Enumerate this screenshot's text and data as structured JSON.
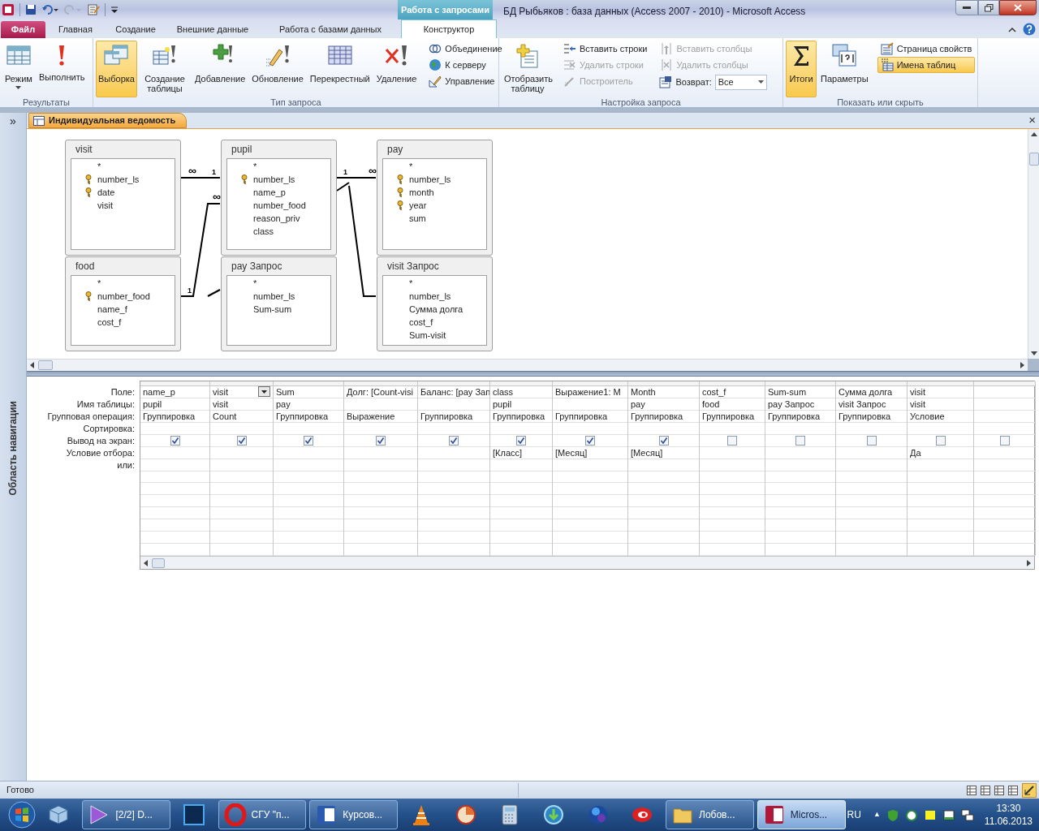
{
  "window": {
    "title": "БД Рыбьяков : база данных (Access 2007 - 2010)  -  Microsoft Access",
    "context_tab": "Работа с запросами"
  },
  "tabs": [
    {
      "label": "Файл",
      "kind": "file",
      "selected": false
    },
    {
      "label": "Главная",
      "kind": "tab",
      "selected": false
    },
    {
      "label": "Создание",
      "kind": "tab",
      "selected": false
    },
    {
      "label": "Внешние данные",
      "kind": "tab",
      "selected": false
    },
    {
      "label": "Работа с базами данных",
      "kind": "tab",
      "selected": false
    },
    {
      "label": "Конструктор",
      "kind": "tab",
      "selected": true
    }
  ],
  "ribbon": {
    "groups": [
      {
        "label": "Результаты",
        "items": [
          {
            "kind": "split",
            "label": "Режим",
            "selected": false,
            "disabled": false
          },
          {
            "kind": "large",
            "label": "Выполнить",
            "selected": false,
            "disabled": false
          }
        ]
      },
      {
        "label": "Тип запроса",
        "items": [
          {
            "kind": "large",
            "label": "Выборка",
            "selected": true,
            "disabled": false
          },
          {
            "kind": "large",
            "label": "Создание таблицы",
            "selected": false,
            "disabled": false
          },
          {
            "kind": "large",
            "label": "Добавление",
            "selected": false,
            "disabled": false
          },
          {
            "kind": "large",
            "label": "Обновление",
            "selected": false,
            "disabled": false
          },
          {
            "kind": "large",
            "label": "Перекрестный",
            "selected": false,
            "disabled": false
          },
          {
            "kind": "large",
            "label": "Удаление",
            "selected": false,
            "disabled": false
          },
          {
            "kind": "small",
            "label": "Объединение",
            "selected": false,
            "disabled": false
          },
          {
            "kind": "small",
            "label": "К серверу",
            "selected": false,
            "disabled": false
          },
          {
            "kind": "small",
            "label": "Управление",
            "selected": false,
            "disabled": false
          }
        ]
      },
      {
        "label": "Настройка запроса",
        "items": [
          {
            "kind": "large",
            "label": "Отобразить таблицу",
            "selected": false,
            "disabled": false
          },
          {
            "kind": "small",
            "label": "Вставить строки",
            "selected": false,
            "disabled": false
          },
          {
            "kind": "small",
            "label": "Удалить строки",
            "selected": false,
            "disabled": true
          },
          {
            "kind": "small",
            "label": "Построитель",
            "selected": false,
            "disabled": true
          },
          {
            "kind": "small",
            "label": "Вставить столбцы",
            "selected": false,
            "disabled": true
          },
          {
            "kind": "small",
            "label": "Удалить столбцы",
            "selected": false,
            "disabled": true
          },
          {
            "kind": "select",
            "label": "Возврат:",
            "value": "Все"
          }
        ]
      },
      {
        "label": "Показать или скрыть",
        "items": [
          {
            "kind": "large",
            "label": "Итоги",
            "selected": true,
            "disabled": false
          },
          {
            "kind": "large",
            "label": "Параметры",
            "selected": false,
            "disabled": false
          },
          {
            "kind": "small",
            "label": "Страница свойств",
            "selected": false,
            "disabled": false
          },
          {
            "kind": "small",
            "label": "Имена таблиц",
            "selected": true,
            "disabled": false
          }
        ]
      }
    ]
  },
  "nav_pane": {
    "toggle": "»",
    "title": "Область навигации"
  },
  "document_tab": {
    "title": "Индивидуальная ведомость",
    "close": "×"
  },
  "diagram": {
    "tables": [
      {
        "name": "visit",
        "fields": [
          {
            "name": "*",
            "key": false
          },
          {
            "name": "number_ls",
            "key": true
          },
          {
            "name": "date",
            "key": true
          },
          {
            "name": "visit",
            "key": false
          }
        ]
      },
      {
        "name": "pupil",
        "fields": [
          {
            "name": "*",
            "key": false
          },
          {
            "name": "number_ls",
            "key": true
          },
          {
            "name": "name_p",
            "key": false
          },
          {
            "name": "number_food",
            "key": false
          },
          {
            "name": "reason_priv",
            "key": false
          },
          {
            "name": "class",
            "key": false
          }
        ]
      },
      {
        "name": "pay",
        "fields": [
          {
            "name": "*",
            "key": false
          },
          {
            "name": "number_ls",
            "key": true
          },
          {
            "name": "month",
            "key": true
          },
          {
            "name": "year",
            "key": true
          },
          {
            "name": "sum",
            "key": false
          }
        ]
      },
      {
        "name": "food",
        "fields": [
          {
            "name": "*",
            "key": false
          },
          {
            "name": "number_food",
            "key": true
          },
          {
            "name": "name_f",
            "key": false
          },
          {
            "name": "cost_f",
            "key": false
          }
        ]
      },
      {
        "name": "pay Запрос",
        "fields": [
          {
            "name": "*",
            "key": false
          },
          {
            "name": "number_ls",
            "key": false
          },
          {
            "name": "Sum-sum",
            "key": false
          }
        ]
      },
      {
        "name": "visit Запрос",
        "fields": [
          {
            "name": "*",
            "key": false
          },
          {
            "name": "number_ls",
            "key": false
          },
          {
            "name": "Сумма долга",
            "key": false
          },
          {
            "name": "cost_f",
            "key": false
          },
          {
            "name": "Sum-visit",
            "key": false
          }
        ]
      }
    ],
    "joins": [
      {
        "left_mark": "∞",
        "right_mark": "1"
      },
      {
        "left_mark": "1",
        "right_mark": "∞"
      },
      {
        "left_mark": "1",
        "right_mark": "∞"
      }
    ]
  },
  "grid": {
    "row_labels": [
      "Поле:",
      "Имя таблицы:",
      "Групповая операция:",
      "Сортировка:",
      "Вывод на экран:",
      "Условие отбора:",
      "или:"
    ],
    "columns": [
      {
        "field": "name_p",
        "table": "pupil",
        "total": "Группировка",
        "show": true
      },
      {
        "field": "visit",
        "table": "visit",
        "total": "Count",
        "show": true,
        "dropdown": true
      },
      {
        "field": "Sum",
        "table": "pay",
        "total": "Группировка",
        "show": true
      },
      {
        "field": "Долг: [Count-visi",
        "total": "Выражение",
        "show": true
      },
      {
        "field": "Баланс: [pay Зап",
        "total": "Группировка",
        "show": true
      },
      {
        "field": "class",
        "table": "pupil",
        "total": "Группировка",
        "show": true,
        "criteria": "[Класс]"
      },
      {
        "field": "Выражение1: М",
        "total": "Группировка",
        "show": true,
        "criteria": "[Месяц]"
      },
      {
        "field": "Month",
        "table": "pay",
        "total": "Группировка",
        "show": true,
        "criteria": "[Месяц]"
      },
      {
        "field": "cost_f",
        "table": "food",
        "total": "Группировка",
        "show": false
      },
      {
        "field": "Sum-sum",
        "table": "pay Запрос",
        "total": "Группировка",
        "show": false
      },
      {
        "field": "Сумма долга",
        "table": "visit Запрос",
        "total": "Группировка",
        "show": false
      },
      {
        "field": "visit",
        "table": "visit",
        "total": "Условие",
        "show": false,
        "criteria": "Да"
      },
      {
        "show": false
      }
    ]
  },
  "status_bar": {
    "text": "Готово"
  },
  "taskbar": {
    "items": [
      {
        "selected": false
      },
      {
        "label": "[2/2] D...",
        "selected": false
      },
      {
        "selected": false
      },
      {
        "label": "СГУ \"п...",
        "selected": false
      },
      {
        "label": "Курсов...",
        "selected": false
      },
      {
        "selected": false
      },
      {
        "selected": false
      },
      {
        "selected": false
      },
      {
        "selected": false
      },
      {
        "selected": false
      },
      {
        "selected": false
      },
      {
        "label": "Лобов...",
        "selected": false
      },
      {
        "label": "Micros...",
        "selected": true
      }
    ],
    "language": "RU",
    "tray_toggle": "▲",
    "time": "13:30",
    "date": "11.06.2013"
  }
}
